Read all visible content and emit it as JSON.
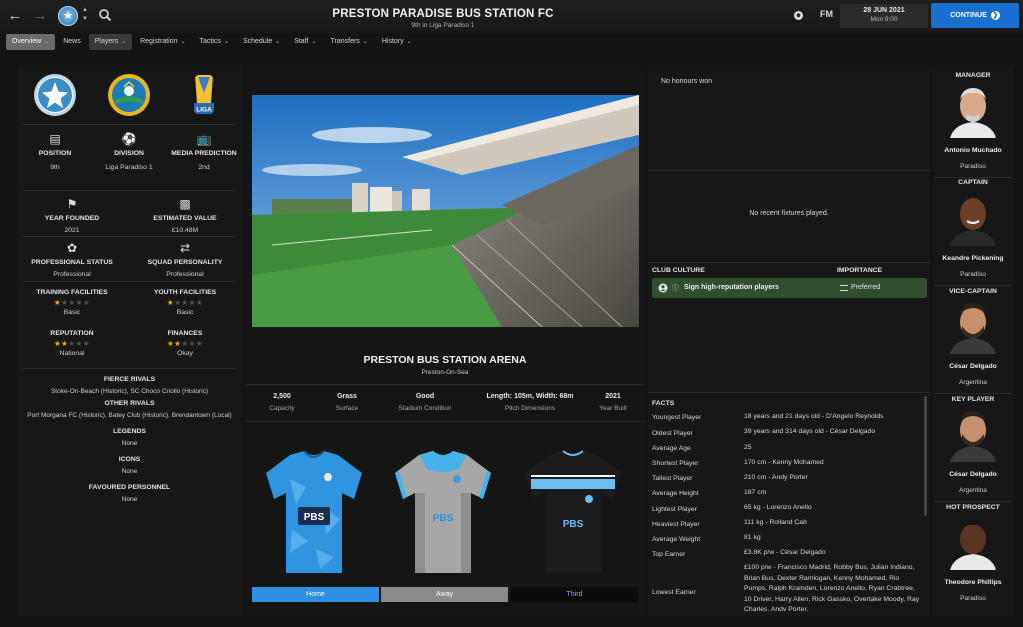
{
  "header": {
    "back_icon": "arrow-left-icon",
    "forward_icon": "arrow-right-icon",
    "club_name": "PRESTON PARADISE BUS STATION FC",
    "club_subtitle": "9th in Liga Paradiso 1",
    "fm_label": "FM",
    "date": "28 JUN 2021",
    "day_time": "Mon 9:00",
    "continue_label": "CONTINUE"
  },
  "tabs": [
    {
      "label": "Overview",
      "active": true
    },
    {
      "label": "News"
    },
    {
      "label": "Players"
    },
    {
      "label": "Registration"
    },
    {
      "label": "Tactics"
    },
    {
      "label": "Schedule"
    },
    {
      "label": "Staff"
    },
    {
      "label": "Transfers"
    },
    {
      "label": "History"
    }
  ],
  "left": {
    "liga_badge_text": "LIGA",
    "position": {
      "label": "POSITION",
      "value": "9th"
    },
    "division": {
      "label": "DIVISION",
      "value": "Liga Paradiso 1"
    },
    "media": {
      "label": "MEDIA PREDICTION",
      "value": "2nd"
    },
    "year_founded": {
      "label": "YEAR FOUNDED",
      "value": "2021"
    },
    "estimated_value": {
      "label": "ESTIMATED VALUE",
      "value": "£10.48M"
    },
    "professional_status": {
      "label": "PROFESSIONAL STATUS",
      "value": "Professional"
    },
    "squad_personality": {
      "label": "SQUAD PERSONALITY",
      "value": "Professional"
    },
    "training": {
      "label": "TRAINING FACILITIES",
      "value": "Basic",
      "stars": 1
    },
    "youth": {
      "label": "YOUTH FACILITIES",
      "value": "Basic",
      "stars": 1
    },
    "reputation": {
      "label": "REPUTATION",
      "value": "National",
      "stars": 2
    },
    "finances": {
      "label": "FINANCES",
      "value": "Okay",
      "stars": 2
    },
    "fierce_rivals": {
      "label": "FIERCE RIVALS",
      "value": "Stoke-On-Beach (Historic), SC Choco Criollo (Historic)"
    },
    "other_rivals": {
      "label": "OTHER RIVALS",
      "value": "Port Morgana FC (Historic), Batey Club (Historic), Brendantown (Local)"
    },
    "legends": {
      "label": "LEGENDS",
      "value": "None"
    },
    "icons": {
      "label": "ICONS",
      "value": "None"
    },
    "favoured": {
      "label": "FAVOURED PERSONNEL",
      "value": "None"
    }
  },
  "center": {
    "arena_name": "PRESTON BUS STATION ARENA",
    "arena_location": "Preston-On-Sea",
    "stats": [
      {
        "value": "2,500",
        "label": "Capacity"
      },
      {
        "value": "Grass",
        "label": "Surface"
      },
      {
        "value": "Good",
        "label": "Stadium Condition"
      },
      {
        "value": "Length: 105m, Width: 68m",
        "label": "Pitch Dimensions"
      },
      {
        "value": "2021",
        "label": "Year Built"
      }
    ],
    "kit_sponsor": "PBS",
    "kit_tabs": [
      "Home",
      "Away",
      "Third"
    ],
    "kit_tab_colors": [
      "#2f8fe0",
      "#8a8a8a",
      "#0c0c0c"
    ]
  },
  "right": {
    "honours": "No honours won",
    "fixtures": "No recent fixtures played.",
    "club_culture_header": "CLUB CULTURE",
    "importance_header": "IMPORTANCE",
    "culture_item": "Sign high-reputation players",
    "culture_importance": "Preferred",
    "facts_title": "FACTS",
    "facts": [
      {
        "label": "Youngest Player",
        "value": "18 years and 21 days old - D'Angelo Reynolds"
      },
      {
        "label": "Oldest Player",
        "value": "39 years and 314 days old - César Delgado"
      },
      {
        "label": "Average Age",
        "value": "25"
      },
      {
        "label": "Shortest Player",
        "value": "170 cm - Kenny Mohamed"
      },
      {
        "label": "Tallest Player",
        "value": "210 cm - Andy Porter"
      },
      {
        "label": "Average Height",
        "value": "187 cm"
      },
      {
        "label": "Lightest Player",
        "value": "65 kg - Lorenzo Anello"
      },
      {
        "label": "Heaviest Player",
        "value": "111 kg - Rolland Cab"
      },
      {
        "label": "Average Weight",
        "value": "81 kg"
      },
      {
        "label": "Top Earner",
        "value": "£3.8K p/w - César Delgado"
      },
      {
        "label": "Lowest Earner",
        "value": "£100 p/w - Francisco Madrid, Robby Bus, Julian Indiano, Brian Bus, Dexter Ramlogan, Kenny Mohamed, Rio Pumps, Ralph Kramden, Lorenzo Anello, Ryan Crabtree, 10 Driver, Harry Allen, Rick Gassko, Overtake Moody, Ray Charles, Andy Porter,"
      }
    ]
  },
  "staff": [
    {
      "role": "MANAGER",
      "name": "Antonio Muchado",
      "club": "Paradiso"
    },
    {
      "role": "CAPTAIN",
      "name": "Keandre Pickening",
      "club": "Paradiso"
    },
    {
      "role": "VICE-CAPTAIN",
      "name": "César Delgado",
      "club": "Argentina"
    },
    {
      "role": "KEY PLAYER",
      "name": "César Delgado",
      "club": "Argentina"
    },
    {
      "role": "HOT PROSPECT",
      "name": "Theodore Phillips",
      "club": "Paradiso"
    }
  ]
}
